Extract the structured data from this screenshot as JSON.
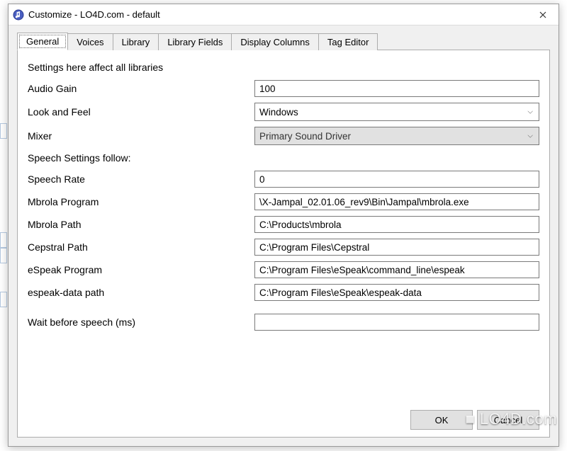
{
  "window": {
    "title": "Customize - LO4D.com - default",
    "icon_name": "music-note-icon"
  },
  "tabs": [
    {
      "label": "General",
      "active": true
    },
    {
      "label": "Voices"
    },
    {
      "label": "Library"
    },
    {
      "label": "Library Fields"
    },
    {
      "label": "Display Columns"
    },
    {
      "label": "Tag Editor"
    }
  ],
  "general": {
    "heading1": "Settings here affect all libraries",
    "audio_gain_label": "Audio Gain",
    "audio_gain_value": "100",
    "look_feel_label": "Look and Feel",
    "look_feel_value": "Windows",
    "mixer_label": "Mixer",
    "mixer_value": "Primary Sound Driver",
    "heading2": "Speech Settings follow:",
    "speech_rate_label": "Speech Rate",
    "speech_rate_value": "0",
    "mbrola_prog_label": "Mbrola Program",
    "mbrola_prog_value": "\\X-Jampal_02.01.06_rev9\\Bin\\Jampal\\mbrola.exe",
    "mbrola_path_label": "Mbrola Path",
    "mbrola_path_value": "C:\\Products\\mbrola",
    "cepstral_path_label": "Cepstral Path",
    "cepstral_path_value": "C:\\Program Files\\Cepstral",
    "espeak_prog_label": "eSpeak Program",
    "espeak_prog_value": "C:\\Program Files\\eSpeak\\command_line\\espeak",
    "espeak_data_label": "espeak-data path",
    "espeak_data_value": "C:\\Program Files\\eSpeak\\espeak-data",
    "wait_label": "Wait before speech (ms)",
    "wait_value": ""
  },
  "buttons": {
    "ok": "OK",
    "cancel": "Cancel"
  },
  "watermark": "■ LO4D.com"
}
